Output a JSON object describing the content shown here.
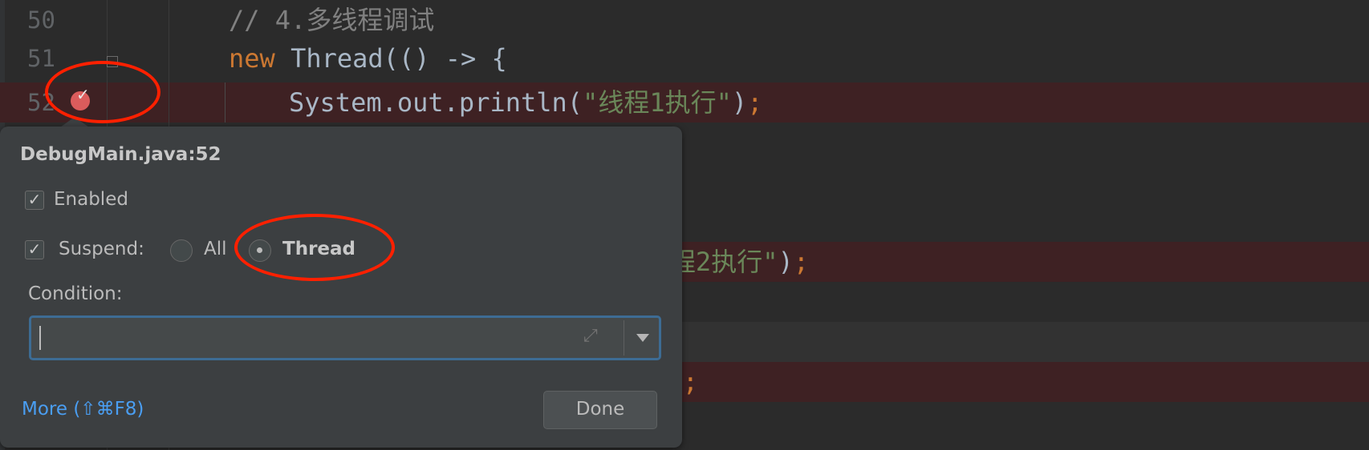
{
  "editor": {
    "line_numbers": [
      "50",
      "51",
      "52"
    ],
    "lines": {
      "l50_comment": "// 4.多线程调试",
      "l51_kw": "new",
      "l51_rest": " Thread(() -> {",
      "l52_code": "System.out.println(",
      "l52_str": "\"线程1执行\"",
      "l52_close": ")",
      "semicolon": ";",
      "l56_str_tail": "程2执行\"",
      "l56_close": ")",
      "l59_close": ")"
    },
    "breakpoint_icon": "breakpoint-check-icon",
    "colors": {
      "breakpoint_line": "#3e2123",
      "keyword": "#cc7832",
      "string": "#6a8759",
      "comment": "#808080"
    }
  },
  "popup": {
    "title": "DebugMain.java:52",
    "enabled": {
      "label": "Enabled",
      "checked": true
    },
    "suspend": {
      "label": "Suspend:",
      "checked": true,
      "options": [
        "All",
        "Thread"
      ],
      "selected": "Thread"
    },
    "condition": {
      "label": "Condition:",
      "value": ""
    },
    "more_link": "More (⇧⌘F8)",
    "done_label": "Done",
    "check_glyph": "✓",
    "expand_glyph": "⤢"
  },
  "annotations": {
    "color": "#ff2000"
  }
}
